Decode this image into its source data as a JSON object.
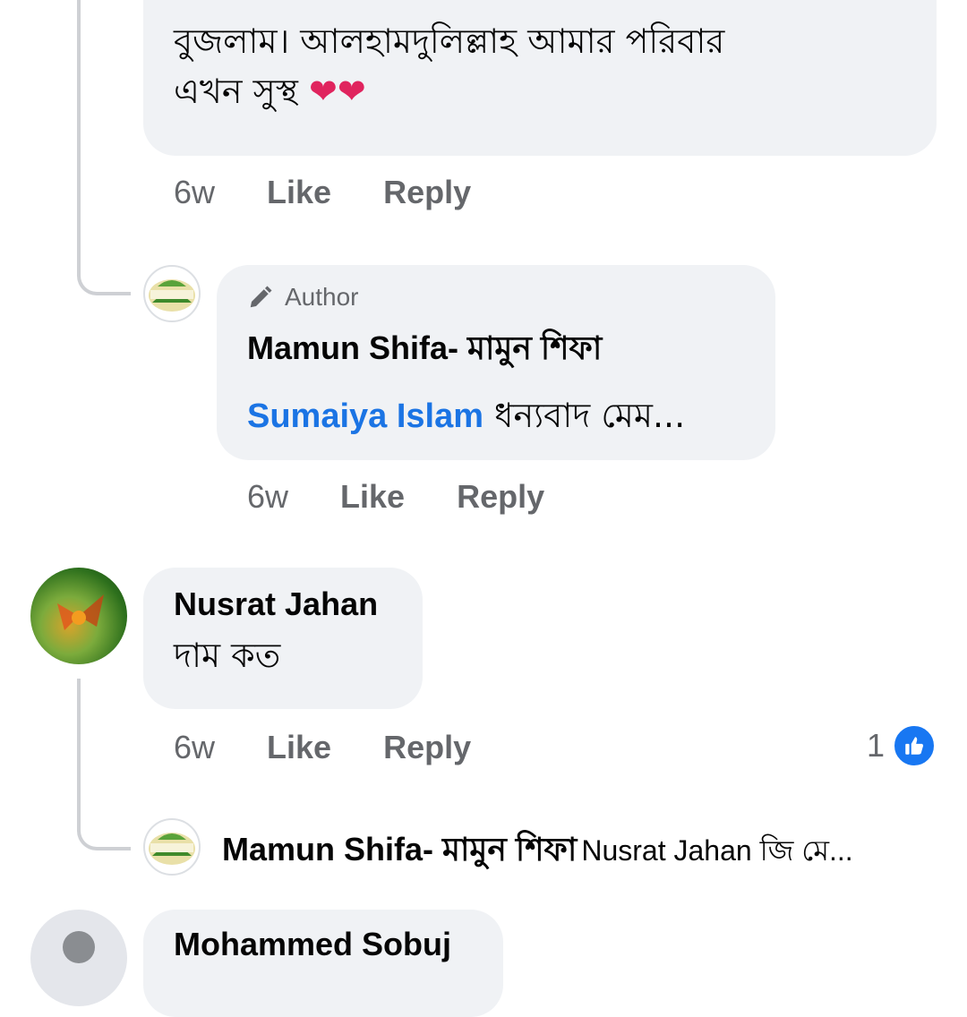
{
  "comments": [
    {
      "text_line1": "বুজলাম। আলহামদুলিল্লাহ আমার পরিবার",
      "text_line2": "এখন সুস্থ",
      "hearts": "❤❤",
      "time": "6w",
      "like": "Like",
      "reply": "Reply"
    },
    {
      "badge": "Author",
      "author": "Mamun Shifa- মামুন শিফা",
      "mention": "Sumaiya Islam",
      "text": "ধন্যবাদ মেম...",
      "time": "6w",
      "like": "Like",
      "reply": "Reply"
    },
    {
      "author": "Nusrat Jahan",
      "text": "দাম কত",
      "time": "6w",
      "like": "Like",
      "reply": "Reply",
      "reaction_count": "1"
    },
    {
      "author": "Mamun Shifa- মামুন শিফা",
      "text": "Nusrat Jahan জি মে..."
    },
    {
      "author": "Mohammed Sobuj"
    }
  ],
  "logo_text": "Mamun Shifa",
  "colors": {
    "bubble": "#f0f2f5",
    "link": "#1b74e4",
    "meta": "#65676b",
    "like_blue": "#1877f2"
  }
}
